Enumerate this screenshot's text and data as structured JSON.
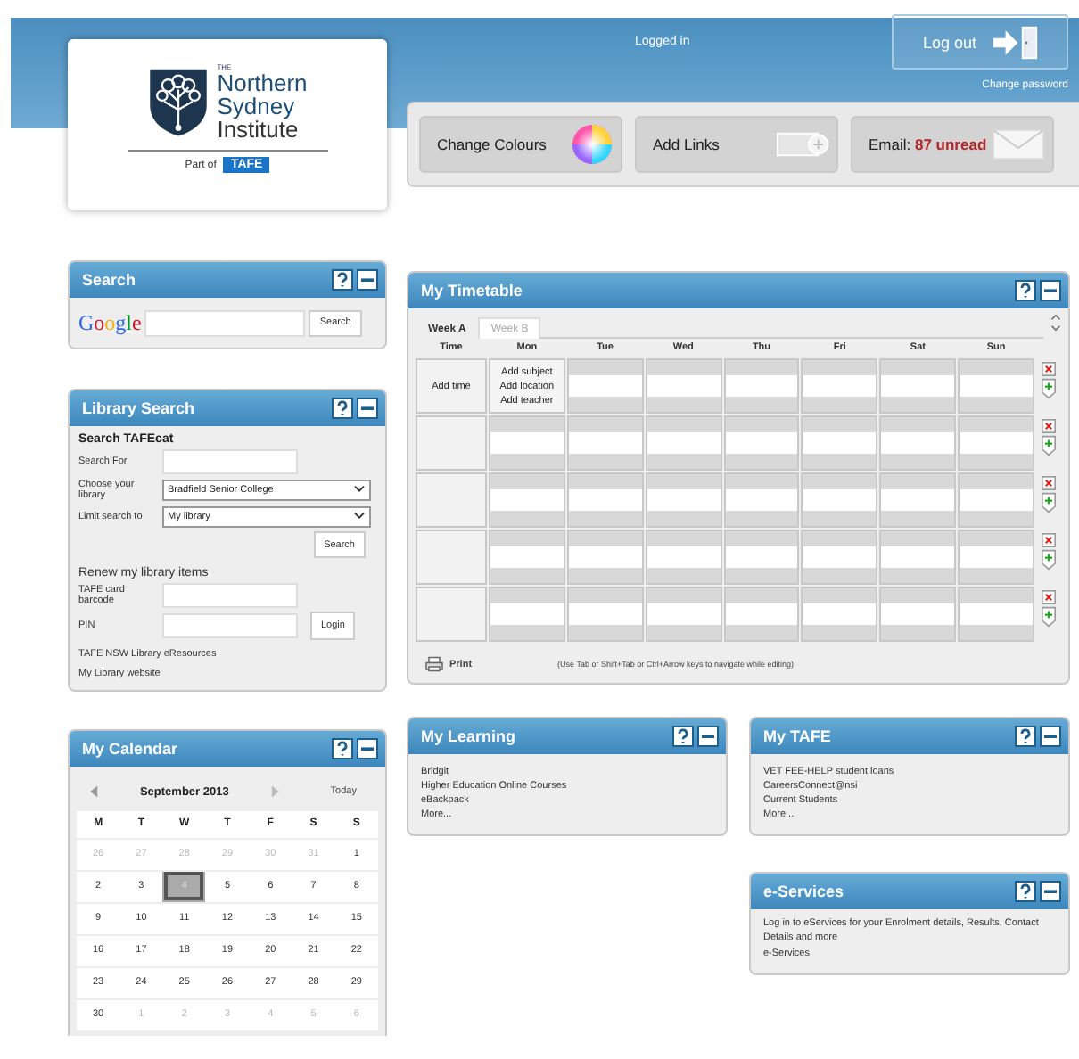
{
  "logo": {
    "the": "THE",
    "name": [
      "Northern",
      "Sydney",
      "Institute"
    ],
    "part_of": "Part of",
    "tafe": "TAFE"
  },
  "header": {
    "logged_in": "Logged in",
    "logout": "Log out",
    "change_password": "Change password"
  },
  "toolbar": [
    {
      "kind": "colours",
      "label": "Change Colours"
    },
    {
      "kind": "links",
      "label": "Add Links"
    },
    {
      "kind": "email",
      "label": "Email:",
      "count": "87 unread"
    }
  ],
  "search_panel": {
    "title": "Search",
    "brand": "Google",
    "button": "Search"
  },
  "library_search": {
    "title": "Library Search",
    "heading": "Search TAFEcat",
    "fields": [
      {
        "kind": "text",
        "label": "Search For"
      },
      {
        "kind": "select",
        "label": "Choose your library",
        "value": "Bradfield Senior College"
      },
      {
        "kind": "select",
        "label": "Limit search to",
        "value": "My library"
      }
    ],
    "search_button": "Search",
    "renew_heading": "Renew my library items",
    "renew_fields": [
      {
        "label": "TAFE card barcode"
      },
      {
        "label": "PIN"
      }
    ],
    "login_button": "Login",
    "links": [
      "TAFE NSW Library eResources",
      "My Library website"
    ]
  },
  "calendar": {
    "title": "My Calendar",
    "month": "September 2013",
    "today": "Today",
    "weekdays": [
      "M",
      "T",
      "W",
      "T",
      "F",
      "S",
      "S"
    ],
    "weeks": [
      [
        {
          "d": "26",
          "outside": true,
          "selected": false
        },
        {
          "d": "27",
          "outside": true,
          "selected": false
        },
        {
          "d": "28",
          "outside": true,
          "selected": false
        },
        {
          "d": "29",
          "outside": true,
          "selected": false
        },
        {
          "d": "30",
          "outside": true,
          "selected": false
        },
        {
          "d": "31",
          "outside": true,
          "selected": false
        },
        {
          "d": "1",
          "outside": false,
          "selected": false
        }
      ],
      [
        {
          "d": "2",
          "outside": false,
          "selected": false
        },
        {
          "d": "3",
          "outside": false,
          "selected": false
        },
        {
          "d": "4",
          "outside": false,
          "selected": true
        },
        {
          "d": "5",
          "outside": false,
          "selected": false
        },
        {
          "d": "6",
          "outside": false,
          "selected": false
        },
        {
          "d": "7",
          "outside": false,
          "selected": false
        },
        {
          "d": "8",
          "outside": false,
          "selected": false
        }
      ],
      [
        {
          "d": "9",
          "outside": false,
          "selected": false
        },
        {
          "d": "10",
          "outside": false,
          "selected": false
        },
        {
          "d": "11",
          "outside": false,
          "selected": false
        },
        {
          "d": "12",
          "outside": false,
          "selected": false
        },
        {
          "d": "13",
          "outside": false,
          "selected": false
        },
        {
          "d": "14",
          "outside": false,
          "selected": false
        },
        {
          "d": "15",
          "outside": false,
          "selected": false
        }
      ],
      [
        {
          "d": "16",
          "outside": false,
          "selected": false
        },
        {
          "d": "17",
          "outside": false,
          "selected": false
        },
        {
          "d": "18",
          "outside": false,
          "selected": false
        },
        {
          "d": "19",
          "outside": false,
          "selected": false
        },
        {
          "d": "20",
          "outside": false,
          "selected": false
        },
        {
          "d": "21",
          "outside": false,
          "selected": false
        },
        {
          "d": "22",
          "outside": false,
          "selected": false
        }
      ],
      [
        {
          "d": "23",
          "outside": false,
          "selected": false
        },
        {
          "d": "24",
          "outside": false,
          "selected": false
        },
        {
          "d": "25",
          "outside": false,
          "selected": false
        },
        {
          "d": "26",
          "outside": false,
          "selected": false
        },
        {
          "d": "27",
          "outside": false,
          "selected": false
        },
        {
          "d": "28",
          "outside": false,
          "selected": false
        },
        {
          "d": "29",
          "outside": false,
          "selected": false
        }
      ],
      [
        {
          "d": "30",
          "outside": false,
          "selected": false
        },
        {
          "d": "1",
          "outside": true,
          "selected": false
        },
        {
          "d": "2",
          "outside": true,
          "selected": false
        },
        {
          "d": "3",
          "outside": true,
          "selected": false
        },
        {
          "d": "4",
          "outside": true,
          "selected": false
        },
        {
          "d": "5",
          "outside": true,
          "selected": false
        },
        {
          "d": "6",
          "outside": true,
          "selected": false
        }
      ]
    ]
  },
  "timetable": {
    "title": "My Timetable",
    "tabs": [
      {
        "label": "Week A",
        "selected": true
      },
      {
        "label": "Week B",
        "selected": false
      }
    ],
    "columns": [
      "Time",
      "Mon",
      "Tue",
      "Wed",
      "Thu",
      "Fri",
      "Sat",
      "Sun"
    ],
    "rows": [
      {
        "kind": "entry",
        "time": "Add time",
        "lines": [
          "Add subject",
          "Add location",
          "Add teacher"
        ]
      },
      {
        "kind": "blank"
      },
      {
        "kind": "blank"
      },
      {
        "kind": "blank"
      },
      {
        "kind": "blank"
      }
    ],
    "print": "Print",
    "hint": "(Use Tab or Shift+Tab or Ctrl+Arrow keys to navigate while editing)"
  },
  "my_learning": {
    "title": "My Learning",
    "links": [
      "Bridgit",
      "Higher Education Online Courses",
      "eBackpack",
      "More..."
    ]
  },
  "my_tafe": {
    "title": "My TAFE",
    "links": [
      "VET FEE-HELP student loans",
      "CareersConnect@nsi",
      "Current Students",
      "More..."
    ]
  },
  "e_services": {
    "title": "e-Services",
    "text": "Log in to eServices for your Enrolment details, Results, Contact Details and more",
    "link": "e-Services"
  }
}
